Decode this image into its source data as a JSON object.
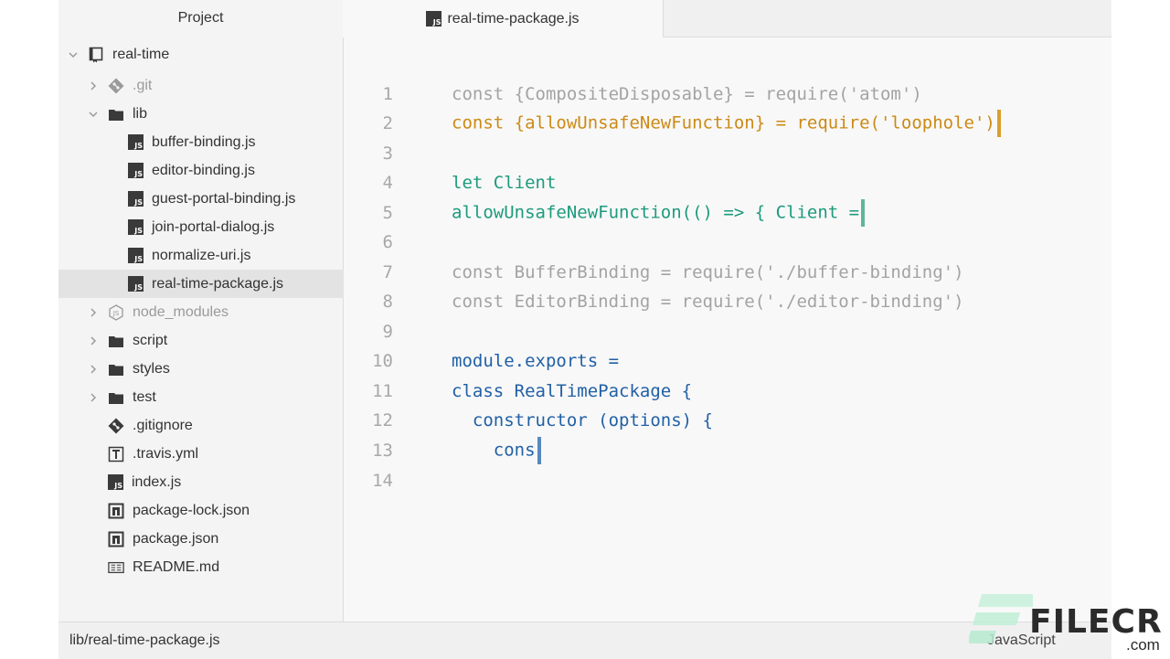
{
  "sidebar": {
    "title": "Project",
    "items": [
      {
        "label": "real-time",
        "icon": "repo-icon",
        "chevron": "down"
      },
      {
        "label": ".git",
        "icon": "git-icon",
        "chevron": "right"
      },
      {
        "label": "lib",
        "icon": "folder-icon",
        "chevron": "down"
      },
      {
        "label": "buffer-binding.js",
        "icon": "js-file-icon"
      },
      {
        "label": "editor-binding.js",
        "icon": "js-file-icon"
      },
      {
        "label": "guest-portal-binding.js",
        "icon": "js-file-icon"
      },
      {
        "label": "join-portal-dialog.js",
        "icon": "js-file-icon"
      },
      {
        "label": "normalize-uri.js",
        "icon": "js-file-icon"
      },
      {
        "label": "real-time-package.js",
        "icon": "js-file-icon",
        "selected": true
      },
      {
        "label": "node_modules",
        "icon": "node-icon",
        "chevron": "right"
      },
      {
        "label": "script",
        "icon": "folder-icon",
        "chevron": "right"
      },
      {
        "label": "styles",
        "icon": "folder-icon",
        "chevron": "right"
      },
      {
        "label": "test",
        "icon": "folder-icon",
        "chevron": "right"
      },
      {
        "label": ".gitignore",
        "icon": "git-icon"
      },
      {
        "label": ".travis.yml",
        "icon": "yaml-icon"
      },
      {
        "label": "index.js",
        "icon": "js-file-icon"
      },
      {
        "label": "package-lock.json",
        "icon": "npm-icon"
      },
      {
        "label": "package.json",
        "icon": "npm-icon"
      },
      {
        "label": "README.md",
        "icon": "markdown-icon"
      }
    ]
  },
  "tab": {
    "label": "real-time-package.js",
    "icon_text": "JS"
  },
  "editor": {
    "lines": [
      {
        "num": "1",
        "text": "const {CompositeDisposable} = require('atom')"
      },
      {
        "num": "2",
        "text": "const {allowUnsafeNewFunction} = require('loophole')"
      },
      {
        "num": "3",
        "text": ""
      },
      {
        "num": "4",
        "text": "let Client"
      },
      {
        "num": "5",
        "text": "allowUnsafeNewFunction(() => { Client ="
      },
      {
        "num": "6",
        "text": ""
      },
      {
        "num": "7",
        "text": "const BufferBinding = require('./buffer-binding')"
      },
      {
        "num": "8",
        "text": "const EditorBinding = require('./editor-binding')"
      },
      {
        "num": "9",
        "text": ""
      },
      {
        "num": "10",
        "text": "module.exports ="
      },
      {
        "num": "11",
        "text": "class RealTimePackage {"
      },
      {
        "num": "12",
        "text": "  constructor (options) {"
      },
      {
        "num": "13",
        "text": "    cons"
      },
      {
        "num": "14",
        "text": ""
      }
    ]
  },
  "statusbar": {
    "path": "lib/real-time-package.js",
    "language": "JavaScript"
  },
  "watermark": {
    "brand": "FILECR",
    "domain": ".com"
  },
  "colors": {
    "orange": "#cc8a16",
    "green": "#1d9a7d",
    "blue": "#2160a6",
    "gray": "#a3a3a3"
  }
}
